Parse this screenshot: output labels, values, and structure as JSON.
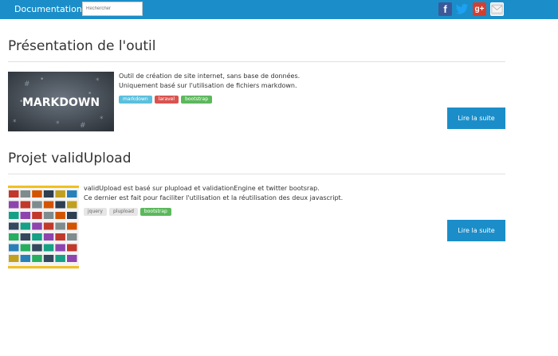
{
  "navbar": {
    "brand": "Documentation",
    "search_placeholder": "Rechercher",
    "social": [
      {
        "name": "facebook",
        "glyph": "f",
        "color": "#3b5998"
      },
      {
        "name": "twitter",
        "color": "#1da1f2"
      },
      {
        "name": "google-plus",
        "glyph": "g+",
        "color": "#d23f31"
      },
      {
        "name": "mail"
      }
    ]
  },
  "colors": {
    "primary": "#1b8ec9",
    "tag_info": "#5bc0de",
    "tag_danger": "#d9534f",
    "tag_success": "#5cb85c",
    "tag_default": "#e6e6e6"
  },
  "articles": [
    {
      "title": "Présentation de l'outil",
      "image_text": "MARKDOWN",
      "lines": [
        "Outil de création de site internet, sans base de données.",
        "Uniquement basé sur l'utilisation de fichiers markdown."
      ],
      "tags": [
        {
          "label": "markdown",
          "style": "info"
        },
        {
          "label": "laravel",
          "style": "danger"
        },
        {
          "label": "bootstrap",
          "style": "success"
        }
      ],
      "button": "Lire la suite"
    },
    {
      "title": "Projet validUpload",
      "lines": [
        "validUpload est basé sur plupload et validationEngine et twitter bootsrap.",
        "Ce dernier est fait pour faciliter l'utilisation et la réutilisation des deux javascript."
      ],
      "tags": [
        {
          "label": "jquery",
          "style": "default"
        },
        {
          "label": "plupload",
          "style": "default"
        },
        {
          "label": "bootstrap",
          "style": "success"
        }
      ],
      "button": "Lire la suite"
    }
  ]
}
